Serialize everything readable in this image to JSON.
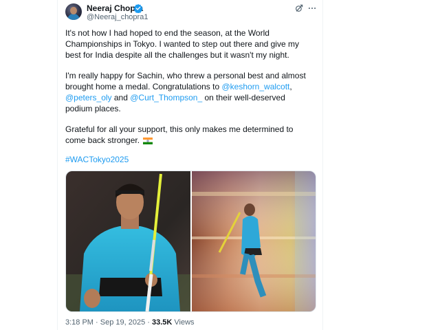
{
  "user": {
    "name": "Neeraj Chopra",
    "handle": "@Neeraj_chopra1"
  },
  "tweet": {
    "p1": "It's not how I had hoped to end the season, at the World Championships in Tokyo. I wanted to step out there and give my best for India despite all the challenges but it wasn't my night.",
    "p2_a": "I'm really happy for Sachin, who threw a personal best and almost brought home a medal. Congratulations to ",
    "mention1": "@keshorn_walcott",
    "p2_b": ",",
    "mention2": "@peters_oly",
    "p2_c": " and ",
    "mention3": "@Curt_Thompson_",
    "p2_d": " on their well-deserved podium places.",
    "p3": "Grateful for all your support, this only makes me determined to come back stronger.",
    "hashtag": "#WACTokyo2025"
  },
  "meta": {
    "time": "3:18 PM",
    "sep": " · ",
    "date": "Sep 19, 2025",
    "views_count": "33.5K",
    "views_label": "Views"
  },
  "colors": {
    "accent": "#1d9bf0",
    "text": "#0f1419",
    "secondary": "#536471"
  },
  "icons": [
    "verified-icon",
    "grok-icon",
    "more-icon",
    "india-flag-icon"
  ]
}
